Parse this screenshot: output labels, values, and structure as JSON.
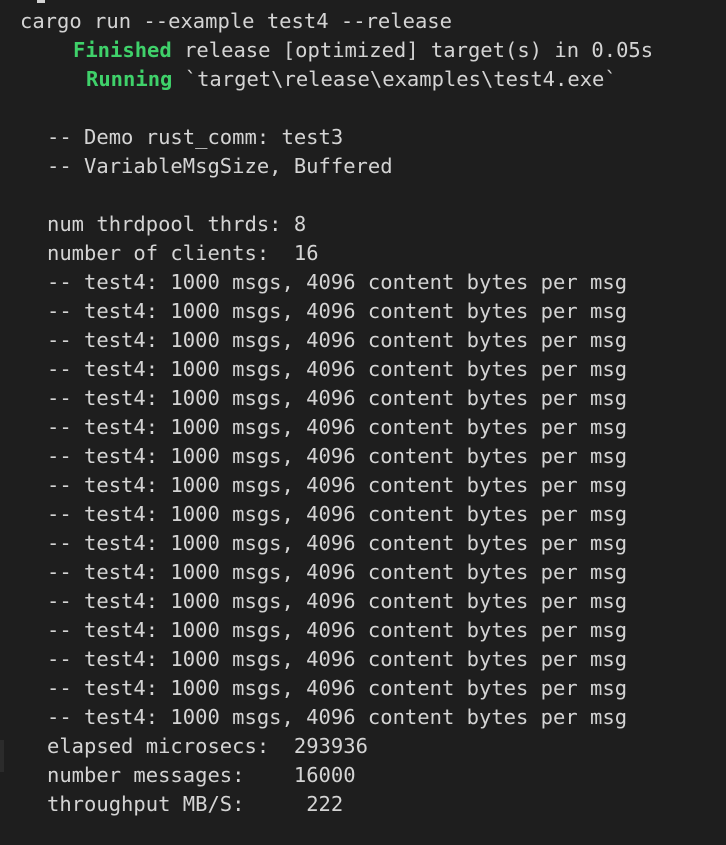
{
  "terminal": {
    "command": "cargo run --example test4 --release",
    "build": {
      "finished_keyword": "Finished",
      "finished_text": "release [optimized] target(s) in 0.05s",
      "running_keyword": "Running",
      "running_text": "`target\\release\\examples\\test4.exe`"
    },
    "demo": {
      "title": "-- Demo rust_comm: test3",
      "mode": "-- VariableMsgSize, Buffered"
    },
    "config": {
      "threads_label": "num thrdpool thrds:",
      "threads_value": "8",
      "clients_label": "number of clients:",
      "clients_value": "16"
    },
    "test_lines": [
      "-- test4: 1000 msgs, 4096 content bytes per msg",
      "-- test4: 1000 msgs, 4096 content bytes per msg",
      "-- test4: 1000 msgs, 4096 content bytes per msg",
      "-- test4: 1000 msgs, 4096 content bytes per msg",
      "-- test4: 1000 msgs, 4096 content bytes per msg",
      "-- test4: 1000 msgs, 4096 content bytes per msg",
      "-- test4: 1000 msgs, 4096 content bytes per msg",
      "-- test4: 1000 msgs, 4096 content bytes per msg",
      "-- test4: 1000 msgs, 4096 content bytes per msg",
      "-- test4: 1000 msgs, 4096 content bytes per msg",
      "-- test4: 1000 msgs, 4096 content bytes per msg",
      "-- test4: 1000 msgs, 4096 content bytes per msg",
      "-- test4: 1000 msgs, 4096 content bytes per msg",
      "-- test4: 1000 msgs, 4096 content bytes per msg",
      "-- test4: 1000 msgs, 4096 content bytes per msg",
      "-- test4: 1000 msgs, 4096 content bytes per msg"
    ],
    "results": {
      "elapsed_label": "elapsed microsecs:",
      "elapsed_value": "293936",
      "messages_label": "number messages:",
      "messages_value": "16000",
      "throughput_label": "throughput MB/S:",
      "throughput_value": "222"
    },
    "colors": {
      "background": "#1e1e1e",
      "text": "#d4d4d4",
      "success": "#3fd16a"
    }
  }
}
